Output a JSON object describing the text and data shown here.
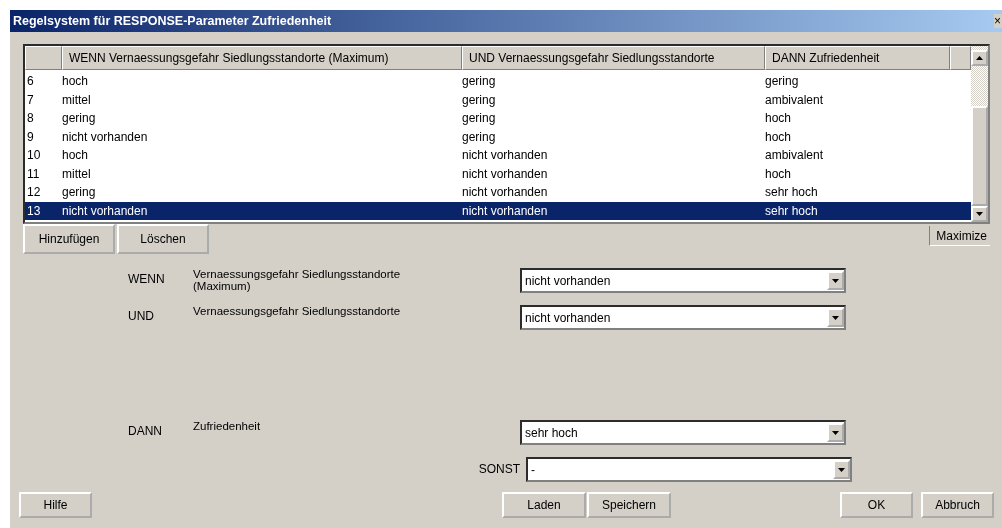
{
  "window": {
    "title": "Regelsystem für RESPONSE-Parameter Zufriedenheit",
    "close": "×"
  },
  "table": {
    "columns": [
      "WENN Vernaessungsgefahr Siedlungsstandorte (Maximum)",
      "UND Vernaessungsgefahr Siedlungsstandorte",
      "DANN Zufriedenheit"
    ],
    "rows": [
      {
        "number": "6",
        "cells": [
          "hoch",
          "gering",
          "gering"
        ],
        "selected": false
      },
      {
        "number": "7",
        "cells": [
          "mittel",
          "gering",
          "ambivalent"
        ],
        "selected": false
      },
      {
        "number": "8",
        "cells": [
          "gering",
          "gering",
          "hoch"
        ],
        "selected": false
      },
      {
        "number": "9",
        "cells": [
          "nicht vorhanden",
          "gering",
          "hoch"
        ],
        "selected": false
      },
      {
        "number": "10",
        "cells": [
          "hoch",
          "nicht vorhanden",
          "ambivalent"
        ],
        "selected": false
      },
      {
        "number": "11",
        "cells": [
          "mittel",
          "nicht vorhanden",
          "hoch"
        ],
        "selected": false
      },
      {
        "number": "12",
        "cells": [
          "gering",
          "nicht vorhanden",
          "sehr hoch"
        ],
        "selected": false
      },
      {
        "number": "13",
        "cells": [
          "nicht vorhanden",
          "nicht vorhanden",
          "sehr hoch"
        ],
        "selected": true
      }
    ]
  },
  "table_buttons": [
    "Hinzufügen",
    "Löschen"
  ],
  "maximize": "Maximize",
  "conditions": [
    {
      "keyword": "WENN",
      "parameter": "Vernaessungsgefahr  Siedlungsstandorte (Maximum)",
      "value": "nicht vorhanden"
    },
    {
      "keyword": "UND",
      "parameter": "Vernaessungsgefahr  Siedlungsstandorte",
      "value": "nicht vorhanden"
    }
  ],
  "conclusion": {
    "keyword": "DANN",
    "parameter": "Zufriedenheit",
    "value": "sehr hoch"
  },
  "otherwise": {
    "label": "SONST",
    "value": "-"
  },
  "buttons": {
    "left": [
      "Hilfe"
    ],
    "center": [
      "Laden",
      "Speichern"
    ],
    "right": [
      "OK",
      "Abbruch"
    ]
  }
}
